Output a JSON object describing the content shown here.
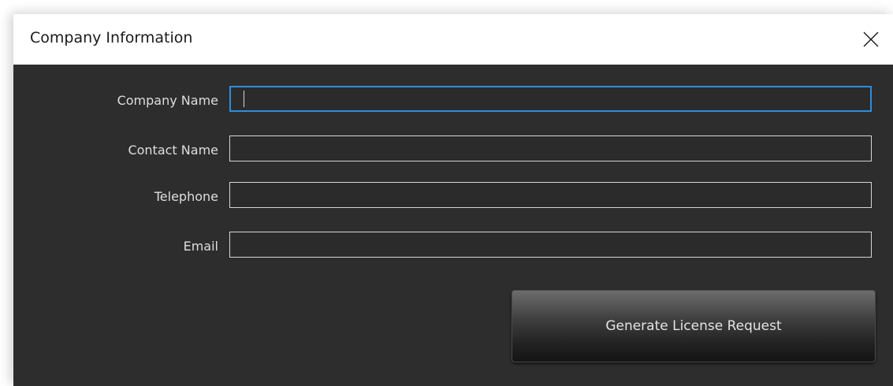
{
  "window": {
    "title": "Company Information",
    "close_icon": "close-icon"
  },
  "form": {
    "fields": [
      {
        "label": "Company Name",
        "value": "",
        "focused": true
      },
      {
        "label": "Contact Name",
        "value": ""
      },
      {
        "label": "Telephone",
        "value": ""
      },
      {
        "label": "Email",
        "value": ""
      }
    ],
    "submit_label": "Generate License Request"
  },
  "colors": {
    "body_background": "#2d2d2d",
    "focus_border": "#2e8ed8",
    "titlebar_background": "#ffffff"
  }
}
